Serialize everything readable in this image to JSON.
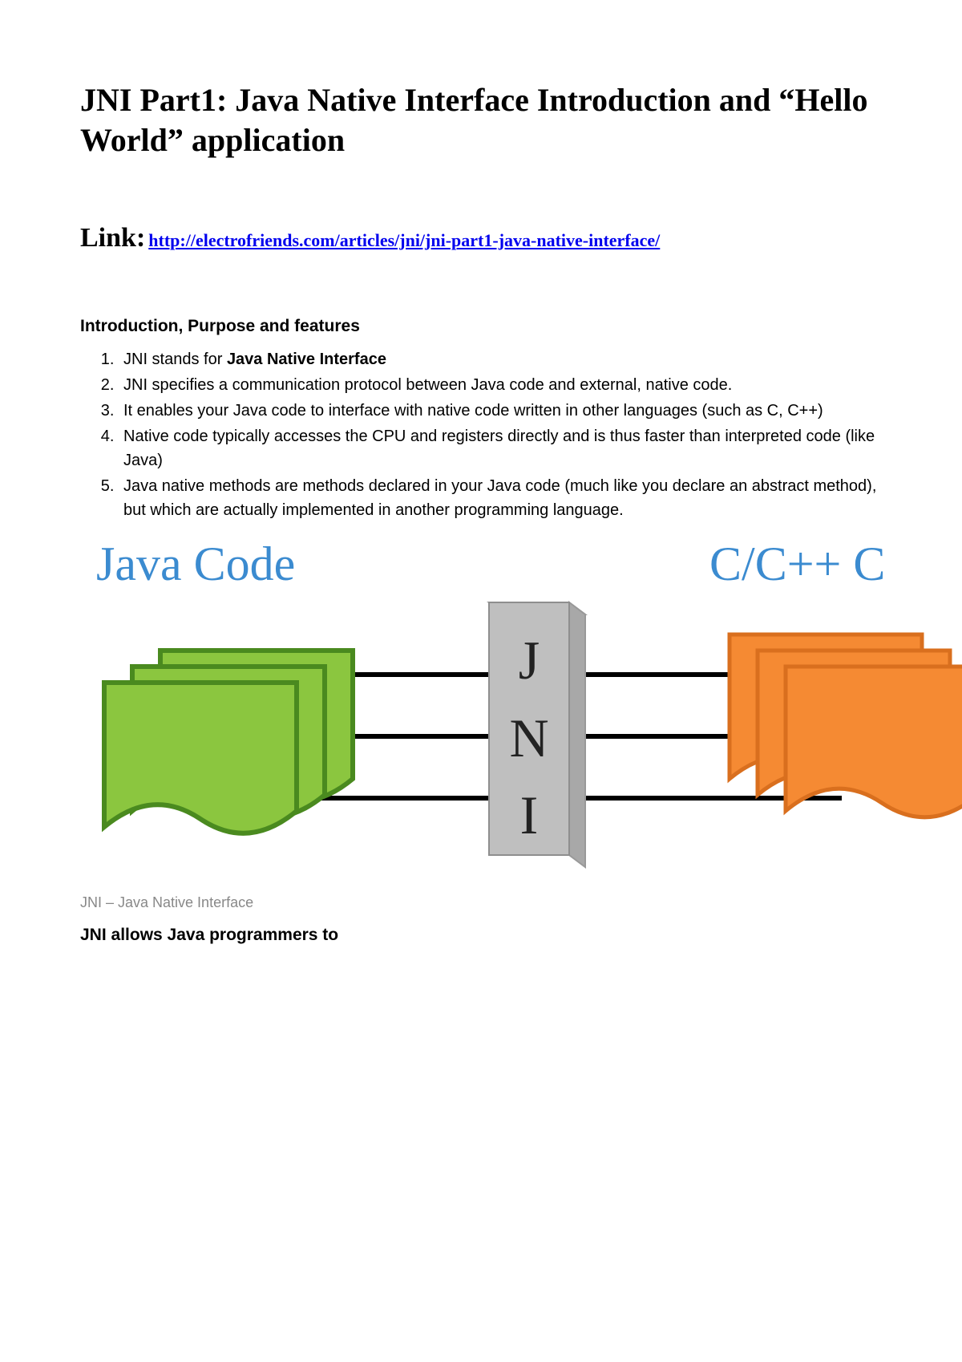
{
  "title": "JNI Part1: Java Native Interface Introduction and “Hello World” application",
  "link": {
    "label": "Link:",
    "url": "http://electrofriends.com/articles/jni/jni-part1-java-native-interface/"
  },
  "intro": {
    "heading": "Introduction, Purpose and features",
    "items": [
      {
        "prefix": "JNI stands for ",
        "bold": "Java Native Interface",
        "suffix": ""
      },
      {
        "prefix": "JNI specifies a communication protocol between Java code and external, native code.",
        "bold": "",
        "suffix": ""
      },
      {
        "prefix": "It enables your Java code to interface with native code written in other languages (such as C, C++)",
        "bold": "",
        "suffix": ""
      },
      {
        "prefix": "Native code typically accesses the CPU and registers directly and is thus faster than interpreted code (like Java)",
        "bold": "",
        "suffix": ""
      },
      {
        "prefix": "Java native methods are methods declared in your Java code (much like you declare an abstract method), but which are actually implemented in another programming language.",
        "bold": "",
        "suffix": ""
      }
    ]
  },
  "diagram": {
    "left_label": "Java Code",
    "right_label": "C/C++ C",
    "center_label_1": "J",
    "center_label_2": "N",
    "center_label_3": "I"
  },
  "caption": "JNI – Java Native Interface",
  "jni_allows": "JNI allows Java programmers to"
}
